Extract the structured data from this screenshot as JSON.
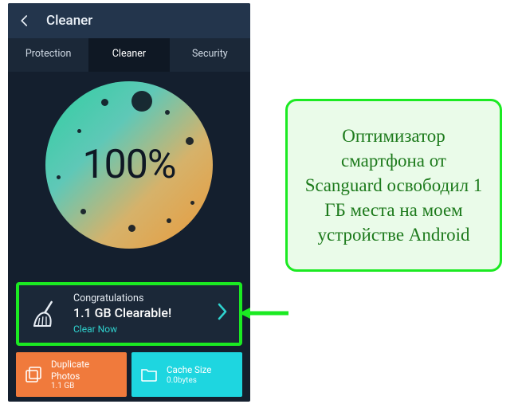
{
  "appbar": {
    "title": "Cleaner"
  },
  "tabs": [
    {
      "label": "Protection",
      "selected": false
    },
    {
      "label": "Cleaner",
      "selected": true
    },
    {
      "label": "Security",
      "selected": false
    }
  ],
  "dial": {
    "percent": "100%"
  },
  "result": {
    "line1": "Congratulations",
    "line2": "1.1 GB Clearable!",
    "action": "Clear Now"
  },
  "tiles": {
    "duplicate": {
      "label": "Duplicate Photos",
      "value": "1.1 GB"
    },
    "cache": {
      "label": "Cache Size",
      "value": "0.0bytes"
    }
  },
  "callout": "Оптимизатор смартфона от Scanguard освободил 1 ГБ места на моем устройстве Android",
  "colors": {
    "highlight": "#1bea22",
    "tile_orange": "#f07a3c",
    "tile_cyan": "#1ed6e0",
    "accent_teal": "#2fd3cf"
  }
}
